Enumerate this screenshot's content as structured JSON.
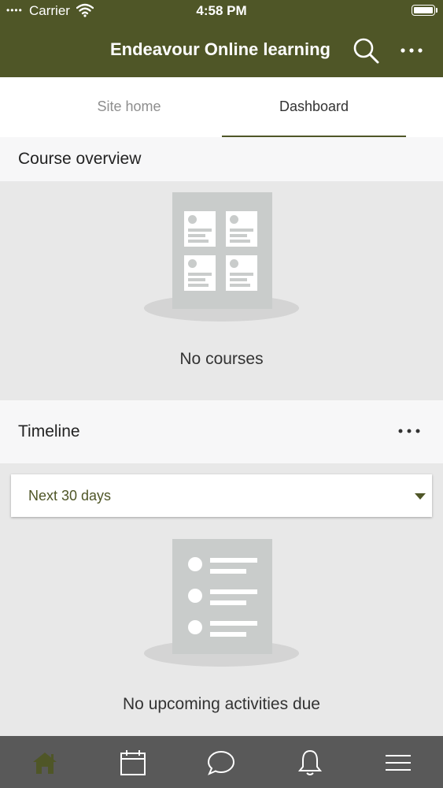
{
  "status_bar": {
    "signal": "••••",
    "carrier": "Carrier",
    "time": "4:58 PM"
  },
  "nav": {
    "title": "Endeavour Online learning"
  },
  "tabs": [
    {
      "label": "Site home",
      "active": false
    },
    {
      "label": "Dashboard",
      "active": true
    }
  ],
  "course_overview": {
    "title": "Course overview",
    "empty_text": "No courses"
  },
  "timeline": {
    "title": "Timeline",
    "filter": {
      "selected": "Next 30 days"
    },
    "empty_text": "No upcoming activities due"
  },
  "bottom_tabs": [
    {
      "icon": "home-icon",
      "active": true
    },
    {
      "icon": "calendar-icon",
      "active": false
    },
    {
      "icon": "messages-icon",
      "active": false
    },
    {
      "icon": "notifications-icon",
      "active": false
    },
    {
      "icon": "menu-icon",
      "active": false
    }
  ],
  "colors": {
    "brand": "#4f5627",
    "tabbar": "#595959",
    "inactive_tab": "#8e8e8e"
  }
}
